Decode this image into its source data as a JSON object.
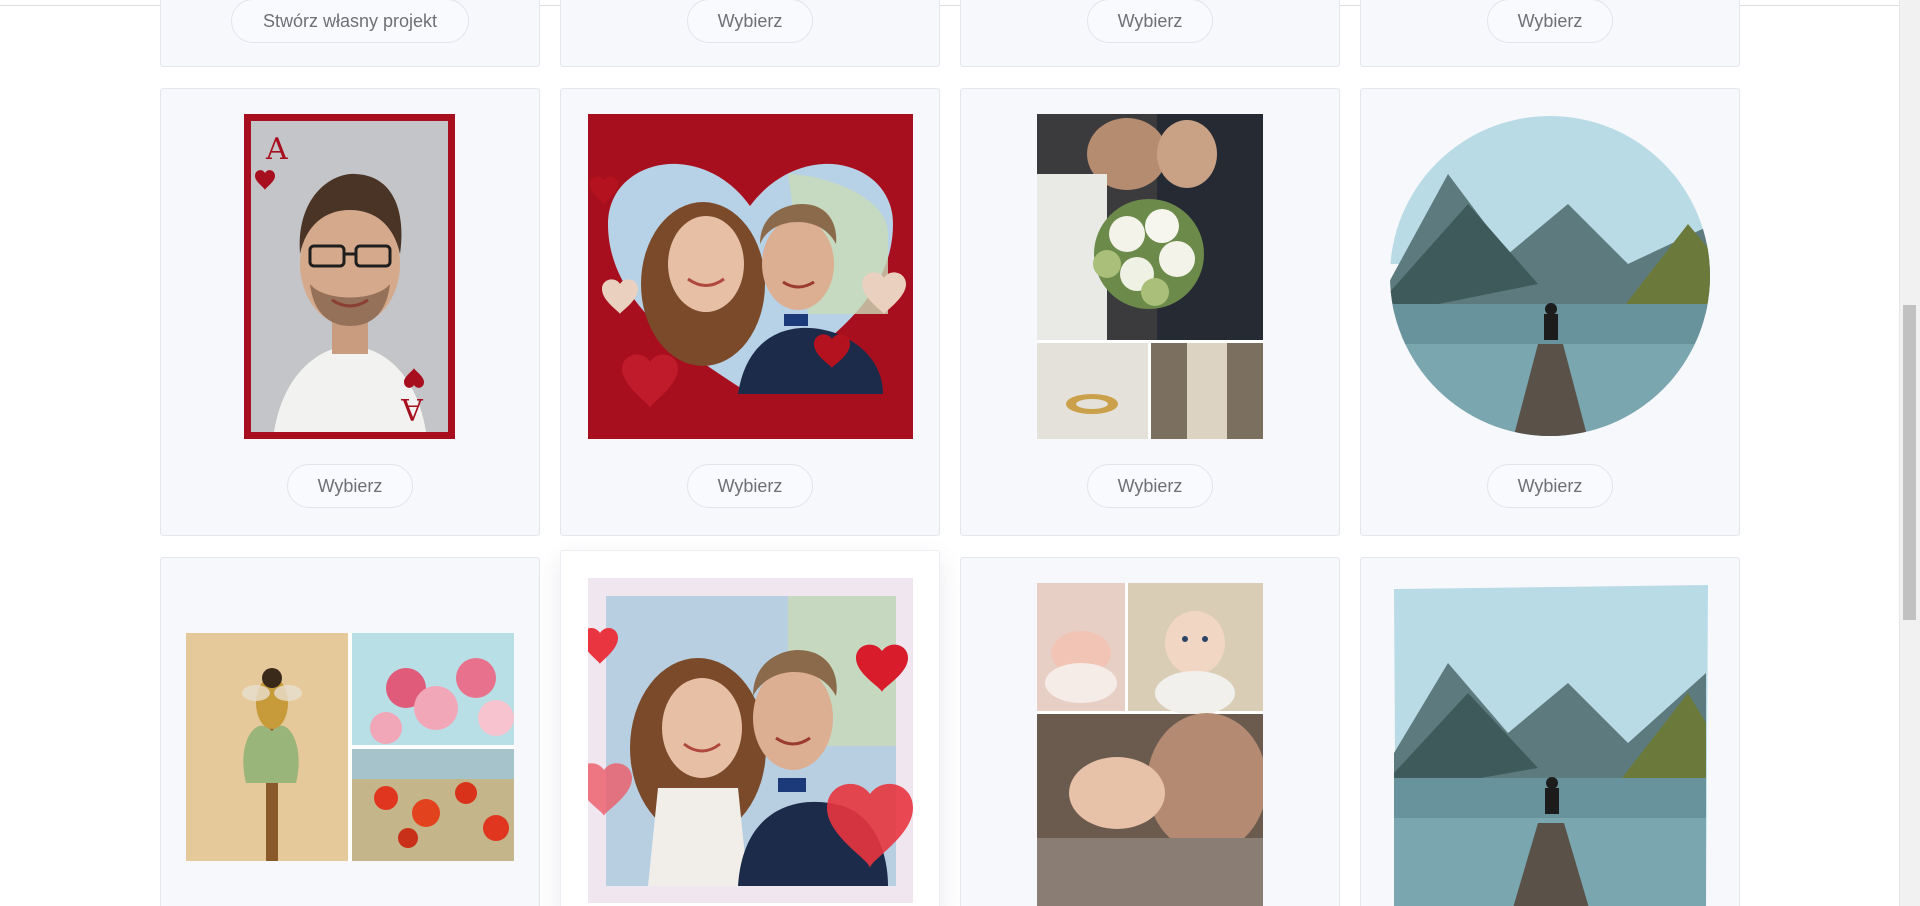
{
  "top_row": {
    "buttons": [
      "Stwórz własny projekt",
      "Wybierz",
      "Wybierz",
      "Wybierz"
    ]
  },
  "templates_row_1": [
    {
      "icon": "playing-card-portrait-icon",
      "button": "Wybierz"
    },
    {
      "icon": "heart-frame-couple-icon",
      "button": "Wybierz"
    },
    {
      "icon": "wedding-collage-icon",
      "button": "Wybierz"
    },
    {
      "icon": "circle-brush-landscape-icon",
      "button": "Wybierz"
    }
  ],
  "templates_row_2": [
    {
      "icon": "bee-flowers-collage-icon"
    },
    {
      "icon": "hearts-frame-couple-icon"
    },
    {
      "icon": "baby-collage-icon"
    },
    {
      "icon": "brush-square-landscape-icon"
    }
  ],
  "colors": {
    "card_bg": "#f7f8fc",
    "card_red": "#a80f1e",
    "button_text": "#6f6f78"
  }
}
